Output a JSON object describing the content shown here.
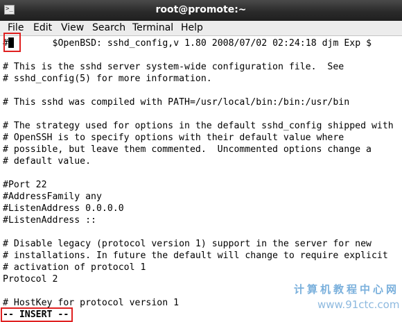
{
  "window": {
    "title": "root@promote:~",
    "icon": "terminal-icon",
    "icon_glyph": ">_"
  },
  "menu": [
    "File",
    "Edit",
    "View",
    "Search",
    "Terminal",
    "Help"
  ],
  "editor": {
    "first_line_prefix": "#",
    "first_line_rest": "       $OpenBSD: sshd_config,v 1.80 2008/07/02 02:24:18 djm Exp $",
    "lines": [
      "",
      "# This is the sshd server system-wide configuration file.  See",
      "# sshd_config(5) for more information.",
      "",
      "# This sshd was compiled with PATH=/usr/local/bin:/bin:/usr/bin",
      "",
      "# The strategy used for options in the default sshd_config shipped with",
      "# OpenSSH is to specify options with their default value where",
      "# possible, but leave them commented.  Uncommented options change a",
      "# default value.",
      "",
      "#Port 22",
      "#AddressFamily any",
      "#ListenAddress 0.0.0.0",
      "#ListenAddress ::",
      "",
      "# Disable legacy (protocol version 1) support in the server for new",
      "# installations. In future the default will change to require explicit",
      "# activation of protocol 1",
      "Protocol 2",
      "",
      "# HostKey for protocol version 1"
    ],
    "status": "-- INSERT --"
  },
  "watermark": {
    "text": "计算机教程中心网",
    "url": "www.91ctc.com"
  },
  "colors": {
    "highlight": "#e02020",
    "titlebar": "#2b2b2b",
    "watermark": "#7ab0dc"
  }
}
